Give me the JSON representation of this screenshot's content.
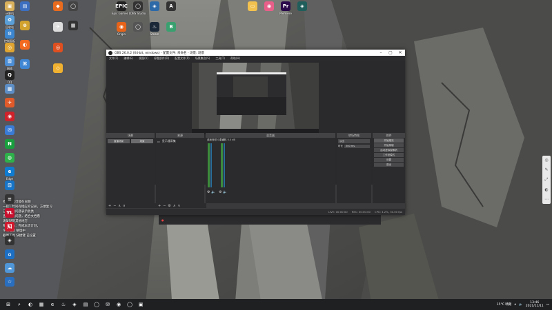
{
  "desktop": {
    "icons_col1": [
      {
        "label": "计算机",
        "color": "#d9b05c",
        "glyph": "▣"
      },
      {
        "label": "回收站",
        "color": "#5a9fd8",
        "glyph": "♻"
      },
      {
        "label": "控制面板",
        "color": "#3c86d0",
        "glyph": "⚙"
      },
      {
        "label": "",
        "color": "#e0a530",
        "glyph": "◎"
      },
      {
        "label": "网络",
        "color": "#4d8fd6",
        "glyph": "⊞"
      },
      {
        "label": "QQ",
        "color": "#222",
        "glyph": "Q"
      },
      {
        "label": "",
        "color": "#5d8ec5",
        "glyph": "▦"
      },
      {
        "label": "",
        "color": "#e05a2a",
        "glyph": "✈"
      },
      {
        "label": "",
        "color": "#d0222a",
        "glyph": "◉"
      },
      {
        "label": "",
        "color": "#3a7bd5",
        "glyph": "✉"
      },
      {
        "label": "",
        "color": "#1a9f3f",
        "glyph": "N"
      },
      {
        "label": "",
        "color": "#2eb04a",
        "glyph": "◍"
      },
      {
        "label": "Edge",
        "color": "#0f7bd1",
        "glyph": "e"
      },
      {
        "label": "",
        "color": "#1874c7",
        "glyph": "⊡"
      },
      {
        "label": "",
        "color": "#333",
        "glyph": "≡"
      },
      {
        "label": "",
        "color": "#c8102e",
        "glyph": "YL"
      },
      {
        "label": "",
        "color": "#d0172b",
        "glyph": "知"
      },
      {
        "label": "",
        "color": "#333",
        "glyph": "◈"
      },
      {
        "label": "",
        "color": "#1d6fc4",
        "glyph": "⌂"
      },
      {
        "label": "",
        "color": "#4f97d8",
        "glyph": "☁"
      },
      {
        "label": "",
        "color": "#2a6fbf",
        "glyph": "☆"
      }
    ],
    "icons_col2": [
      {
        "label": "",
        "color": "#3c6fc0",
        "glyph": "▤"
      },
      {
        "label": "",
        "color": "#d2a22f",
        "glyph": "⊕"
      },
      {
        "label": "",
        "color": "#f16a20",
        "glyph": "◐"
      },
      {
        "label": "",
        "color": "#3f86d4",
        "glyph": "⌘"
      }
    ],
    "icons_col3": [
      {
        "label": "",
        "color": "#e86b1e",
        "glyph": "◆"
      },
      {
        "label": "",
        "color": "#ddd",
        "glyph": "✈"
      },
      {
        "label": "",
        "color": "#e04f1f",
        "glyph": "◎"
      },
      {
        "label": "",
        "color": "#f0b030",
        "glyph": "◇"
      }
    ],
    "icons_col4": [
      {
        "label": "",
        "color": "#444",
        "glyph": "◯"
      },
      {
        "label": "",
        "color": "#333",
        "glyph": "▦"
      }
    ],
    "icons_top": [
      {
        "label": "Epic Games Launcher",
        "color": "#222",
        "glyph": "EPIC"
      },
      {
        "label": "Origin",
        "color": "#e8631a",
        "glyph": "◉"
      },
      {
        "label": "OBS Studio",
        "color": "#333",
        "glyph": "◯"
      },
      {
        "label": "",
        "color": "#555",
        "glyph": "◯"
      },
      {
        "label": "",
        "color": "#2f6aa8",
        "glyph": "◈"
      },
      {
        "label": "Steam",
        "color": "#1b2838",
        "glyph": "♨"
      },
      {
        "label": "",
        "color": "#333",
        "glyph": "A"
      },
      {
        "label": "",
        "color": "#3aa070",
        "glyph": "B"
      }
    ],
    "icons_top_right": [
      {
        "label": "",
        "color": "#f2c14e",
        "glyph": "▭"
      },
      {
        "label": "",
        "color": "#e85f8a",
        "glyph": "◉"
      },
      {
        "label": "Premiere",
        "color": "#2a0a4a",
        "glyph": "Pr"
      },
      {
        "label": "",
        "color": "#1f5e5a",
        "glyph": "◈"
      }
    ],
    "notes": [
      "找到数据可能在日期",
      "一段1 时间有相应的记录，方便复习",
      "已解决的问题表示此类",
      "查找相关问题，结合文档看",
      "请复制到其他地方",
      "每日任务：完成本周计划，",
      "学习笔记 整理中",
      "截图工具 快捷键 已设置"
    ]
  },
  "obs": {
    "title": "OBS 26.0.2 (64-bit, windows) - 配置文件: 未命名 - 场景: 场景",
    "menu": [
      "文件(F)",
      "编辑(E)",
      "视图(V)",
      "停靠部件(D)",
      "配置文件(P)",
      "场景集合(S)",
      "工具(T)",
      "帮助(H)"
    ],
    "preview_bar": [
      "● 混音",
      "● 滤镜"
    ],
    "docks": {
      "scenes": {
        "title": "场景",
        "items": [
          "直播场景",
          "场景"
        ]
      },
      "sources": {
        "title": "来源",
        "items": [
          "显示器采集"
        ]
      },
      "mixer": {
        "title": "混音器",
        "channels": [
          "桌面音频 0.0 dB",
          "麦克风 0.0 dB"
        ]
      },
      "transitions": {
        "title": "转场特效",
        "type": "淡出",
        "duration_label": "时长",
        "duration": "300 ms"
      },
      "controls": {
        "title": "控件",
        "buttons": [
          "开始推流",
          "开始录制",
          "启动虚拟摄像机",
          "工作室模式",
          "设置",
          "退出"
        ]
      }
    },
    "status": {
      "live": "LIVE: 00:00:00",
      "rec": "REC: 00:00:00",
      "cpu": "CPU: 4.2%, 30.00 fps"
    }
  },
  "taskbar": {
    "apps": [
      "⊞",
      "⌕",
      "◐",
      "▦",
      "e",
      "♨",
      "◈",
      "▤",
      "◯",
      "✉",
      "◉",
      "◯",
      "▣"
    ],
    "weather": "15°C 晴朗",
    "time": "13:46",
    "date": "2021/11/11"
  },
  "colors": {
    "accent": "#3c86d0",
    "taskbar": "#1e2022",
    "obs_bg": "#2a292b"
  }
}
